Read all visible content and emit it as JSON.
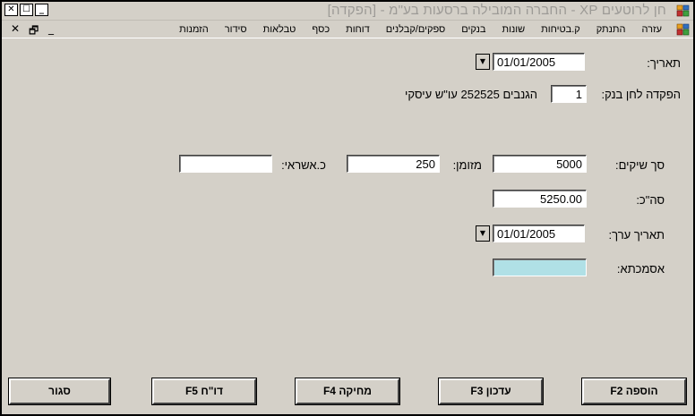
{
  "window": {
    "title": "חן לרוטעים XP - החברה המובילה ברסעות בע\"מ - [הפקדה]",
    "controls": {
      "close": "✕",
      "maximize": "☐",
      "minimize": "_"
    }
  },
  "menu": {
    "items": [
      "הזמנות",
      "סידור",
      "טבלאות",
      "כסף",
      "דוחות",
      "ספקים/קבלנים",
      "בנקים",
      "שונות",
      "ק.בטיחות",
      "התנתק",
      "עזרה"
    ],
    "doc_controls": {
      "close": "✕",
      "restore": "🗗",
      "minimize": "_"
    }
  },
  "form": {
    "date": {
      "label": "תאריך:",
      "value": "01/01/2005"
    },
    "deposit": {
      "label": "הפקדה לחן בנק:",
      "value": "1",
      "account_desc": "הגנבים 252525 עו\"ש עיסקי"
    },
    "checks": {
      "label": "סך שיקים:",
      "value": "5000"
    },
    "cash": {
      "label": "מזומן:",
      "value": "250"
    },
    "credit": {
      "label": "כ.אשראי:",
      "value": ""
    },
    "total": {
      "label": "סה\"כ:",
      "value": "5250.00"
    },
    "value_date": {
      "label": "תאריך ערך:",
      "value": "01/01/2005"
    },
    "reference": {
      "label": "אסמכתא:",
      "value": ""
    }
  },
  "buttons": {
    "add": "הוספה F2",
    "update": "עדכון F3",
    "delete": "מחיקה F4",
    "report": "דו\"ח F5",
    "close": "סגור"
  },
  "colors": {
    "window_bg": "#d4d0c8",
    "reference_field_bg": "#b0e0e6",
    "title_text": "#9c9a96"
  }
}
